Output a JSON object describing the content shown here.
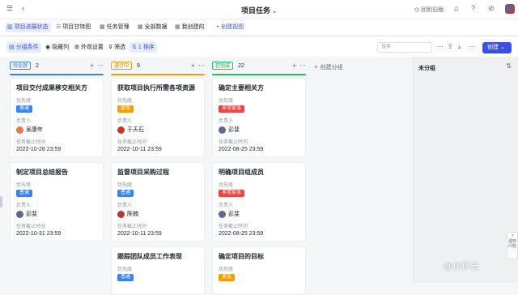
{
  "topbar": {
    "title": "项目任务",
    "old_version": "回到旧版"
  },
  "tabs": [
    {
      "label": "项目进展状态",
      "icon": "kanban-icon"
    },
    {
      "label": "项目甘特图",
      "icon": "gantt-icon"
    },
    {
      "label": "任务管理",
      "icon": "table-icon"
    },
    {
      "label": "全部数据",
      "icon": "table-icon"
    },
    {
      "label": "我创建的",
      "icon": "table-icon"
    },
    {
      "label": "创建视图",
      "icon": "plus-icon"
    }
  ],
  "toolbar": {
    "group_by": "分组条件",
    "hide_cols": "隐藏列",
    "appearance": "外观设置",
    "filter": "筛选",
    "sort": "1 排序",
    "search_placeholder": "搜索",
    "create": "创建"
  },
  "columns": [
    {
      "tag": "待处理",
      "count": "2",
      "color": "#3b82f6",
      "cards": [
        {
          "title": "项目交付成果移交相关方",
          "prio_label": "优先级",
          "prio": "普通",
          "prio_color": "#3b82f6",
          "owner_label": "负责人",
          "owner": "吴康年",
          "deadline_label": "任务截止时间",
          "deadline": "2022-10-28 23:59"
        },
        {
          "title": "制定项目总结报告",
          "prio_label": "优先级",
          "prio": "普通",
          "prio_color": "#3b82f6",
          "owner_label": "负责人",
          "owner": "彭斐",
          "deadline_label": "任务截止时间",
          "deadline": "2022-10-31 23:59"
        }
      ]
    },
    {
      "tag": "进行中",
      "count": "9",
      "color": "#f59e0b",
      "cards": [
        {
          "title": "获取项目执行所需各项资源",
          "prio_label": "优先级",
          "prio": "紧急",
          "prio_color": "#f59e0b",
          "owner_label": "负责人",
          "owner": "于天石",
          "deadline_label": "任务截止时间",
          "deadline": "2022-10-11 23:59"
        },
        {
          "title": "监督项目采购过程",
          "prio_label": "优先级",
          "prio": "普通",
          "prio_color": "#3b82f6",
          "owner_label": "负责人",
          "owner": "陈楠",
          "deadline_label": "任务截止时间",
          "deadline": "2022-10-11 23:59"
        },
        {
          "title": "跟踪团队成员工作表现",
          "prio_label": "优先级",
          "prio": "普通",
          "prio_color": "#3b82f6"
        }
      ]
    },
    {
      "tag": "已完成",
      "count": "22",
      "color": "#22c55e",
      "cards": [
        {
          "title": "确定主要相关方",
          "prio_label": "优先级",
          "prio": "非常紧急",
          "prio_color": "#ef4444",
          "owner_label": "负责人",
          "owner": "彭斐",
          "deadline_label": "任务截止时间",
          "deadline": "2022-08-25 23:59"
        },
        {
          "title": "明确项目组成员",
          "prio_label": "优先级",
          "prio": "非常紧急",
          "prio_color": "#ef4444",
          "owner_label": "负责人",
          "owner": "彭斐",
          "deadline_label": "任务截止时间",
          "deadline": "2022-08-25 23:59"
        },
        {
          "title": "确定项目的目标",
          "prio_label": "优先级",
          "prio": "紧急",
          "prio_color": "#f59e0b"
        }
      ]
    }
  ],
  "add_group": "创建分组",
  "side_panel": {
    "title": "未分组"
  },
  "help": "遇到问题",
  "watermark": "@伙伴云"
}
